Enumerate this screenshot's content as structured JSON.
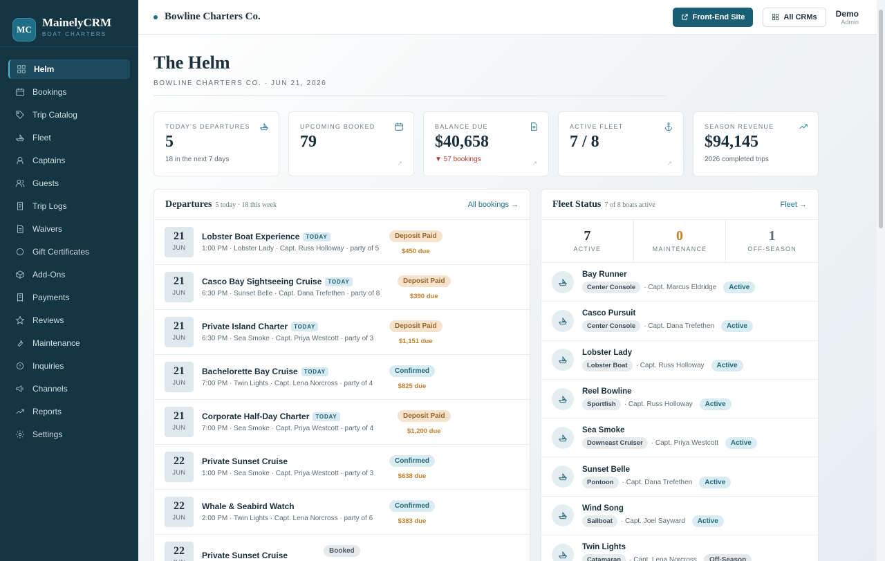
{
  "brand": {
    "initials": "MC",
    "name": "MainelyCRM",
    "sub": "BOAT CHARTERS"
  },
  "sidebar": {
    "items": [
      {
        "label": "Helm",
        "icon": "grid-icon",
        "active": true
      },
      {
        "label": "Bookings",
        "icon": "calendar-icon"
      },
      {
        "label": "Trip Catalog",
        "icon": "tag-icon"
      },
      {
        "label": "Fleet",
        "icon": "boat-icon"
      },
      {
        "label": "Captains",
        "icon": "captain-icon"
      },
      {
        "label": "Guests",
        "icon": "users-icon"
      },
      {
        "label": "Trip Logs",
        "icon": "log-icon"
      },
      {
        "label": "Waivers",
        "icon": "document-icon"
      },
      {
        "label": "Gift Certificates",
        "icon": "circle-icon"
      },
      {
        "label": "Add-Ons",
        "icon": "box-icon"
      },
      {
        "label": "Payments",
        "icon": "receipt-icon"
      },
      {
        "label": "Reviews",
        "icon": "star-icon"
      },
      {
        "label": "Maintenance",
        "icon": "wrench-icon"
      },
      {
        "label": "Inquiries",
        "icon": "inquiry-icon"
      },
      {
        "label": "Channels",
        "icon": "megaphone-icon"
      },
      {
        "label": "Reports",
        "icon": "trend-icon"
      },
      {
        "label": "Settings",
        "icon": "gear-icon"
      }
    ]
  },
  "topbar": {
    "company": "Bowline Charters Co.",
    "frontend_label": "Front-End Site",
    "allcrms_label": "All CRMs",
    "user_name": "Demo",
    "user_role": "Admin"
  },
  "page": {
    "title": "The Helm",
    "subtitle": "BOWLINE CHARTERS CO. · JUN 21, 2026"
  },
  "stats": [
    {
      "label": "TODAY'S DEPARTURES",
      "value": "5",
      "sub": "18 in the next 7 days",
      "icon": "boat-icon",
      "negative": false
    },
    {
      "label": "UPCOMING BOOKED",
      "value": "79",
      "sub": "",
      "icon": "calendar-icon",
      "negative": false
    },
    {
      "label": "BALANCE DUE",
      "value": "$40,658",
      "sub": "▼ 57 bookings",
      "icon": "document-icon",
      "negative": true
    },
    {
      "label": "ACTIVE FLEET",
      "value": "7 / 8",
      "sub": "",
      "icon": "anchor-icon",
      "negative": false
    },
    {
      "label": "SEASON REVENUE",
      "value": "$94,145",
      "sub": "2026 completed trips",
      "icon": "trend-icon",
      "negative": false
    }
  ],
  "departures": {
    "title": "Departures",
    "meta": "5 today · 18 this week",
    "link": "All bookings →",
    "today_label": "TODAY",
    "rows": [
      {
        "day": "21",
        "month": "JUN",
        "title": "Lobster Boat Experience",
        "today": true,
        "meta": "1:00 PM  · Lobster Lady · Capt. Russ Holloway · party of 5",
        "status": "Deposit Paid",
        "kind": "deposit",
        "due": "$450 due"
      },
      {
        "day": "21",
        "month": "JUN",
        "title": "Casco Bay Sightseeing Cruise",
        "today": true,
        "meta": "6:30 PM  · Sunset Belle · Capt. Dana Trefethen · party of 8",
        "status": "Deposit Paid",
        "kind": "deposit",
        "due": "$390 due"
      },
      {
        "day": "21",
        "month": "JUN",
        "title": "Private Island Charter",
        "today": true,
        "meta": "6:30 PM  · Sea Smoke · Capt. Priya Westcott · party of 3",
        "status": "Deposit Paid",
        "kind": "deposit",
        "due": "$1,151 due"
      },
      {
        "day": "21",
        "month": "JUN",
        "title": "Bachelorette Bay Cruise",
        "today": true,
        "meta": "7:00 PM  · Twin Lights · Capt. Lena Norcross · party of 4",
        "status": "Confirmed",
        "kind": "confirmed",
        "due": "$825 due"
      },
      {
        "day": "21",
        "month": "JUN",
        "title": "Corporate Half-Day Charter",
        "today": true,
        "meta": "7:00 PM  · Sea Smoke · Capt. Priya Westcott · party of 4",
        "status": "Deposit Paid",
        "kind": "deposit",
        "due": "$1,200 due"
      },
      {
        "day": "22",
        "month": "JUN",
        "title": "Private Sunset Cruise",
        "today": false,
        "meta": "1:00 PM  · Sea Smoke · Capt. Priya Westcott · party of 3",
        "status": "Confirmed",
        "kind": "confirmed",
        "due": "$638 due"
      },
      {
        "day": "22",
        "month": "JUN",
        "title": "Whale & Seabird Watch",
        "today": false,
        "meta": "2:00 PM  · Twin Lights · Capt. Lena Norcross · party of 6",
        "status": "Confirmed",
        "kind": "confirmed",
        "due": "$383 due"
      },
      {
        "day": "22",
        "month": "JUN",
        "title": "Private Sunset Cruise",
        "today": false,
        "meta": "",
        "status": "Booked",
        "kind": "booked",
        "due": ""
      }
    ]
  },
  "fleet": {
    "title": "Fleet Status",
    "meta": "7 of 8 boats active",
    "link": "Fleet →",
    "counts": [
      {
        "num": "7",
        "label": "ACTIVE",
        "tone": "normal"
      },
      {
        "num": "0",
        "label": "MAINTENANCE",
        "tone": "warn"
      },
      {
        "num": "1",
        "label": "OFF-SEASON",
        "tone": "muted"
      }
    ],
    "boats": [
      {
        "name": "Bay Runner",
        "type": "Center Console",
        "captain": "· Capt. Marcus Eldridge",
        "status": "Active",
        "kind": "active"
      },
      {
        "name": "Casco Pursuit",
        "type": "Center Console",
        "captain": "· Capt. Dana Trefethen",
        "status": "Active",
        "kind": "active"
      },
      {
        "name": "Lobster Lady",
        "type": "Lobster Boat",
        "captain": "· Capt. Russ Holloway",
        "status": "Active",
        "kind": "active"
      },
      {
        "name": "Reel Bowline",
        "type": "Sportfish",
        "captain": "· Capt. Russ Holloway",
        "status": "Active",
        "kind": "active"
      },
      {
        "name": "Sea Smoke",
        "type": "Downeast Cruiser",
        "captain": "· Capt. Priya Westcott",
        "status": "Active",
        "kind": "active"
      },
      {
        "name": "Sunset Belle",
        "type": "Pontoon",
        "captain": "· Capt. Dana Trefethen",
        "status": "Active",
        "kind": "active"
      },
      {
        "name": "Wind Song",
        "type": "Sailboat",
        "captain": "· Capt. Joel Sayward",
        "status": "Active",
        "kind": "active"
      },
      {
        "name": "Twin Lights",
        "type": "Catamaran",
        "captain": "· Capt. Lena Norcross",
        "status": "Off-Season",
        "kind": "off"
      }
    ]
  }
}
